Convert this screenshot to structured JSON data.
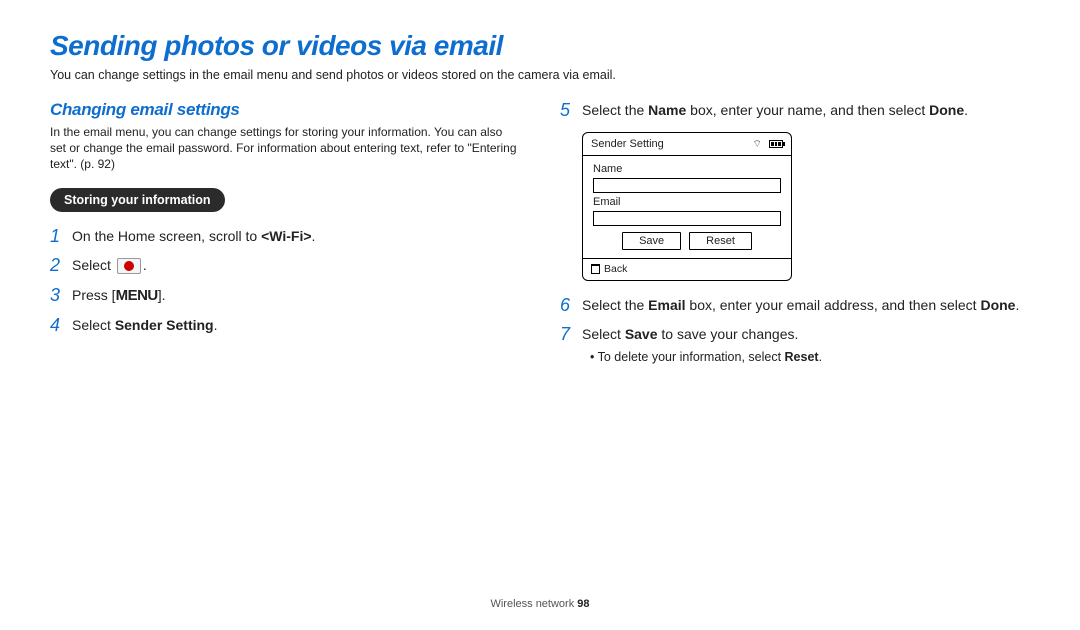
{
  "title": "Sending photos or videos via email",
  "intro": "You can change settings in the email menu and send photos or videos stored on the camera via email.",
  "section": {
    "title": "Changing email settings",
    "desc": "In the email menu, you can change settings for storing your information. You can also set or change the email password. For information about entering text, refer to \"Entering text\". (p. 92)",
    "pill": "Storing your information"
  },
  "steps_left": [
    {
      "num": "1",
      "pre": "On the Home screen, scroll to ",
      "b1": "<Wi-Fi>",
      "post": "."
    },
    {
      "num": "2",
      "pre": "Select ",
      "icon": true,
      "post": "."
    },
    {
      "num": "3",
      "pre": "Press [",
      "menu": "MENU",
      "post": "]."
    },
    {
      "num": "4",
      "pre": "Select ",
      "b1": "Sender Setting",
      "post": "."
    }
  ],
  "steps_right": [
    {
      "num": "5",
      "pre": "Select the ",
      "b1": "Name",
      "mid": " box, enter your name, and then select ",
      "b2": "Done",
      "post": "."
    },
    {
      "num": "6",
      "pre": "Select the ",
      "b1": "Email",
      "mid": " box, enter your email address, and then select ",
      "b2": "Done",
      "post": "."
    },
    {
      "num": "7",
      "pre": "Select ",
      "b1": "Save",
      "post": " to save your changes."
    }
  ],
  "bullet": "To delete your information, select Reset.",
  "bullet_prefix": "•  To delete your information, select ",
  "bullet_bold": "Reset",
  "bullet_suffix": ".",
  "mock": {
    "header": "Sender Setting",
    "name_label": "Name",
    "email_label": "Email",
    "save_btn": "Save",
    "reset_btn": "Reset",
    "back": "Back"
  },
  "footer_label": "Wireless network  ",
  "footer_page": "98"
}
